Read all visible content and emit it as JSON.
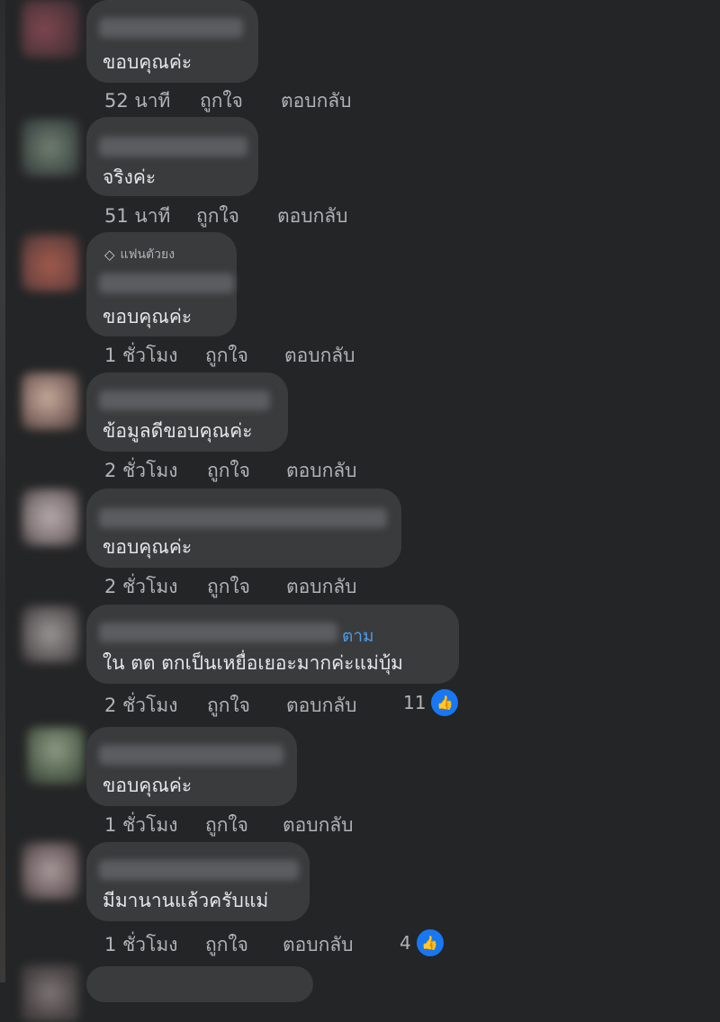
{
  "comments": [
    {
      "text": "ขอบคุณค่ะ",
      "time": "52 นาที",
      "like": "ถูกใจ",
      "reply": "ตอบกลับ"
    },
    {
      "text": "จริงค่ะ",
      "time": "51 นาที",
      "like": "ถูกใจ",
      "reply": "ตอบกลับ"
    },
    {
      "badge": "แฟนตัวยง",
      "text": "ขอบคุณค่ะ",
      "time": "1 ชั่วโมง",
      "like": "ถูกใจ",
      "reply": "ตอบกลับ"
    },
    {
      "text": "ข้อมูลดีขอบคุณค่ะ",
      "time": "2 ชั่วโมง",
      "like": "ถูกใจ",
      "reply": "ตอบกลับ"
    },
    {
      "text": "ขอบคุณค่ะ",
      "time": "2 ชั่วโมง",
      "like": "ถูกใจ",
      "reply": "ตอบกลับ"
    },
    {
      "follow": "ตาม",
      "text": "ใน ตต ตกเป็นเหยื่อเยอะมากค่ะแม่บุ้ม",
      "time": "2 ชั่วโมง",
      "like": "ถูกใจ",
      "reply": "ตอบกลับ",
      "reactions": "11"
    },
    {
      "text": "ขอบคุณค่ะ",
      "time": "1 ชั่วโมง",
      "like": "ถูกใจ",
      "reply": "ตอบกลับ"
    },
    {
      "text": "มีมานานแล้วครับแม่",
      "time": "1 ชั่วโมง",
      "like": "ถูกใจ",
      "reply": "ตอบกลับ",
      "reactions": "4"
    }
  ],
  "colors": {
    "background": "#242526",
    "bubble": "#3a3b3c",
    "link": "#4b9be8",
    "like": "#1877f2"
  },
  "icons": {
    "reaction": "thumbs-up-icon",
    "badge": "diamond-icon"
  }
}
